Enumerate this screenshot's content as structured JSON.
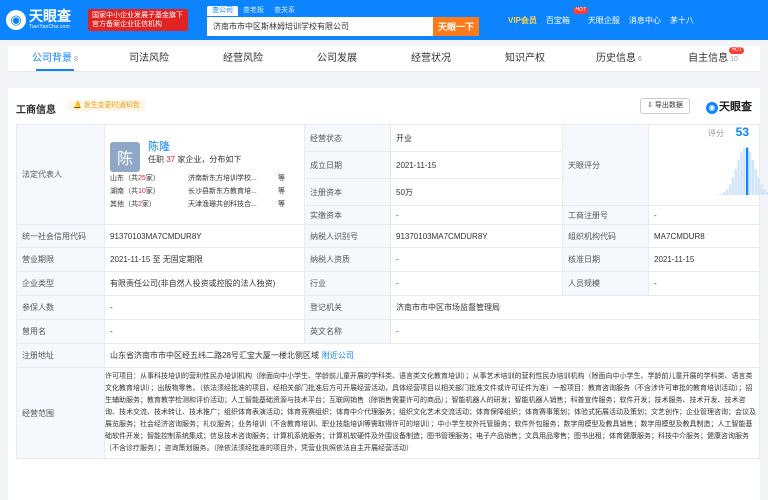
{
  "top": {
    "logo_name": "天眼查",
    "logo_domain": "TianYanCha.com",
    "gov_badge": [
      "国家中小企业发展子基金旗下",
      "官方备案企业征信机构"
    ],
    "search_tabs": [
      "查公司",
      "查老板",
      "查关系"
    ],
    "search_value": "济南市市中区斯林姆培训学校有限公司",
    "search_button": "天眼一下",
    "nav": [
      "VIP会员",
      "百宝箱",
      "天眼企服",
      "消息中心",
      "茅十八"
    ],
    "hot": "HOT"
  },
  "tabs": [
    {
      "label": "公司背景",
      "count": "8"
    },
    {
      "label": "司法风险",
      "count": ""
    },
    {
      "label": "经营风险",
      "count": ""
    },
    {
      "label": "公司发展",
      "count": ""
    },
    {
      "label": "经营状况",
      "count": ""
    },
    {
      "label": "知识产权",
      "count": ""
    },
    {
      "label": "历史信息",
      "count": "6"
    },
    {
      "label": "自主信息",
      "count": "10"
    }
  ],
  "panel": {
    "title": "工商信息",
    "notify": "发生变更时通知我",
    "export": "导出数据",
    "brand": "天眼查"
  },
  "labels": {
    "legal_rep": "法定代表人",
    "status": "经营状态",
    "founded": "成立日期",
    "capital": "注册资本",
    "paid": "实缴资本",
    "score": "天眼评分",
    "reg_no": "工商注册号",
    "credit": "统一社会信用代码",
    "taxpayer": "纳税人识别号",
    "org_code": "组织机构代码",
    "term": "营业期限",
    "tax_qual": "纳税人资质",
    "approved": "核准日期",
    "type": "企业类型",
    "industry": "行业",
    "staff": "人员规模",
    "insured": "参保人数",
    "authority": "登记机关",
    "former": "曾用名",
    "en_name": "英文名称",
    "address": "注册地址",
    "scope": "经营范围"
  },
  "rep": {
    "avatar": "陈",
    "name": "陈隆",
    "sub_a": "任职",
    "sub_n": "37",
    "sub_b": "家企业，分布如下",
    "regions": [
      {
        "prov": "山东",
        "cnt": "25",
        "co": "济南新东方培训学校...",
        "more": "等"
      },
      {
        "prov": "湖南",
        "cnt": "10",
        "co": "长沙县新东方教育培...",
        "more": "等"
      },
      {
        "prov": "其他",
        "cnt": "2",
        "co": "天津渔珊共创科技合...",
        "more": "等"
      }
    ],
    "total_a": "（共",
    "total_b": "家）"
  },
  "values": {
    "status": "开业",
    "founded": "2021-11-15",
    "capital": "50万",
    "paid": "-",
    "reg_no": "-",
    "credit": "91370103MA7CMDUR8Y",
    "taxpayer": "91370103MA7CMDUR8Y",
    "org_code": "MA7CMDUR8",
    "term": "2021-11-15 至 无固定期限",
    "tax_qual": "-",
    "approved": "2021-11-15",
    "type": "有限责任公司(非自然人投资或控股的法人独资)",
    "industry": "-",
    "staff": "-",
    "insured": "-",
    "authority": "济南市市中区市场监督管理局",
    "former": "-",
    "en_name": "-",
    "address": "山东省济南市市中区经五纬二路28号汇宝大厦一楼北侧区域",
    "address_link": "附近公司",
    "scope": "许可项目：从事科技培训的营利性民办培训机构（除面向中小学生、学龄前儿童开展的学科类、语言类文化教育培训）；从事艺术培训的营利性民办培训机构（除面向中小学生、学龄前儿童开展的学科类、语言类文化教育培训）；出版物零售。（依法须经批准的项目，经相关部门批准后方可开展经营活动，具体经营项目以相关部门批准文件或许可证件为准）一般项目：教育咨询服务（不含涉许可审批的教育培训活动）；招生辅助服务；教育教学检测和评价活动；人工智能基础资源与技术平台；互联网销售（除销售需要许可的商品）；智能机器人的研发；智能机器人销售；科普宣传服务；软件开发；技术服务、技术开发、技术咨询、技术交流、技术转让、技术推广；组织体育表演活动；体育竞赛组织；体育中介代理服务；组织文化艺术交流活动；体育保障组织；体育赛事策划；体验式拓展活动及策划；文艺创作；企业管理咨询；会议及展览服务；社会经济咨询服务；礼仪服务；业务培训（不含教育培训、职业技能培训等需取得许可的培训）；中小学生校外托管服务；软件外包服务；数字用模型及教具销售；数字用模型及教具制造；人工智能基础软件开发；智能控制系统集成；信息技术咨询服务；计算机系统服务；计算机软硬件及外围设备制造；图书管理服务；电子产品销售；文具用品零售；图书出租；体育健康服务；科技中介服务；健康咨询服务（不含诊疗服务）；咨询策划服务。（除依法须经批准的项目外，凭营业执照依法自主开展经营活动）"
  },
  "score": {
    "label": "评分",
    "value": 53,
    "max": 100
  },
  "colors": {
    "brand": "#0c84ff",
    "accent": "#ff7a1a",
    "red": "#e02424"
  }
}
